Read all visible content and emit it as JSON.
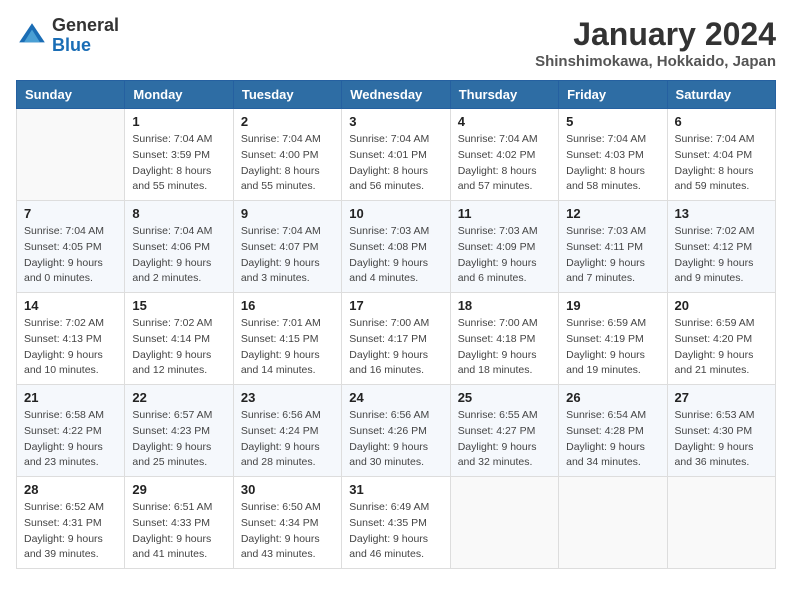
{
  "header": {
    "logo_line1": "General",
    "logo_line2": "Blue",
    "month": "January 2024",
    "location": "Shinshimokawa, Hokkaido, Japan"
  },
  "weekdays": [
    "Sunday",
    "Monday",
    "Tuesday",
    "Wednesday",
    "Thursday",
    "Friday",
    "Saturday"
  ],
  "weeks": [
    [
      {
        "day": "",
        "sunrise": "",
        "sunset": "",
        "daylight": ""
      },
      {
        "day": "1",
        "sunrise": "Sunrise: 7:04 AM",
        "sunset": "Sunset: 3:59 PM",
        "daylight": "Daylight: 8 hours and 55 minutes."
      },
      {
        "day": "2",
        "sunrise": "Sunrise: 7:04 AM",
        "sunset": "Sunset: 4:00 PM",
        "daylight": "Daylight: 8 hours and 55 minutes."
      },
      {
        "day": "3",
        "sunrise": "Sunrise: 7:04 AM",
        "sunset": "Sunset: 4:01 PM",
        "daylight": "Daylight: 8 hours and 56 minutes."
      },
      {
        "day": "4",
        "sunrise": "Sunrise: 7:04 AM",
        "sunset": "Sunset: 4:02 PM",
        "daylight": "Daylight: 8 hours and 57 minutes."
      },
      {
        "day": "5",
        "sunrise": "Sunrise: 7:04 AM",
        "sunset": "Sunset: 4:03 PM",
        "daylight": "Daylight: 8 hours and 58 minutes."
      },
      {
        "day": "6",
        "sunrise": "Sunrise: 7:04 AM",
        "sunset": "Sunset: 4:04 PM",
        "daylight": "Daylight: 8 hours and 59 minutes."
      }
    ],
    [
      {
        "day": "7",
        "sunrise": "Sunrise: 7:04 AM",
        "sunset": "Sunset: 4:05 PM",
        "daylight": "Daylight: 9 hours and 0 minutes."
      },
      {
        "day": "8",
        "sunrise": "Sunrise: 7:04 AM",
        "sunset": "Sunset: 4:06 PM",
        "daylight": "Daylight: 9 hours and 2 minutes."
      },
      {
        "day": "9",
        "sunrise": "Sunrise: 7:04 AM",
        "sunset": "Sunset: 4:07 PM",
        "daylight": "Daylight: 9 hours and 3 minutes."
      },
      {
        "day": "10",
        "sunrise": "Sunrise: 7:03 AM",
        "sunset": "Sunset: 4:08 PM",
        "daylight": "Daylight: 9 hours and 4 minutes."
      },
      {
        "day": "11",
        "sunrise": "Sunrise: 7:03 AM",
        "sunset": "Sunset: 4:09 PM",
        "daylight": "Daylight: 9 hours and 6 minutes."
      },
      {
        "day": "12",
        "sunrise": "Sunrise: 7:03 AM",
        "sunset": "Sunset: 4:11 PM",
        "daylight": "Daylight: 9 hours and 7 minutes."
      },
      {
        "day": "13",
        "sunrise": "Sunrise: 7:02 AM",
        "sunset": "Sunset: 4:12 PM",
        "daylight": "Daylight: 9 hours and 9 minutes."
      }
    ],
    [
      {
        "day": "14",
        "sunrise": "Sunrise: 7:02 AM",
        "sunset": "Sunset: 4:13 PM",
        "daylight": "Daylight: 9 hours and 10 minutes."
      },
      {
        "day": "15",
        "sunrise": "Sunrise: 7:02 AM",
        "sunset": "Sunset: 4:14 PM",
        "daylight": "Daylight: 9 hours and 12 minutes."
      },
      {
        "day": "16",
        "sunrise": "Sunrise: 7:01 AM",
        "sunset": "Sunset: 4:15 PM",
        "daylight": "Daylight: 9 hours and 14 minutes."
      },
      {
        "day": "17",
        "sunrise": "Sunrise: 7:00 AM",
        "sunset": "Sunset: 4:17 PM",
        "daylight": "Daylight: 9 hours and 16 minutes."
      },
      {
        "day": "18",
        "sunrise": "Sunrise: 7:00 AM",
        "sunset": "Sunset: 4:18 PM",
        "daylight": "Daylight: 9 hours and 18 minutes."
      },
      {
        "day": "19",
        "sunrise": "Sunrise: 6:59 AM",
        "sunset": "Sunset: 4:19 PM",
        "daylight": "Daylight: 9 hours and 19 minutes."
      },
      {
        "day": "20",
        "sunrise": "Sunrise: 6:59 AM",
        "sunset": "Sunset: 4:20 PM",
        "daylight": "Daylight: 9 hours and 21 minutes."
      }
    ],
    [
      {
        "day": "21",
        "sunrise": "Sunrise: 6:58 AM",
        "sunset": "Sunset: 4:22 PM",
        "daylight": "Daylight: 9 hours and 23 minutes."
      },
      {
        "day": "22",
        "sunrise": "Sunrise: 6:57 AM",
        "sunset": "Sunset: 4:23 PM",
        "daylight": "Daylight: 9 hours and 25 minutes."
      },
      {
        "day": "23",
        "sunrise": "Sunrise: 6:56 AM",
        "sunset": "Sunset: 4:24 PM",
        "daylight": "Daylight: 9 hours and 28 minutes."
      },
      {
        "day": "24",
        "sunrise": "Sunrise: 6:56 AM",
        "sunset": "Sunset: 4:26 PM",
        "daylight": "Daylight: 9 hours and 30 minutes."
      },
      {
        "day": "25",
        "sunrise": "Sunrise: 6:55 AM",
        "sunset": "Sunset: 4:27 PM",
        "daylight": "Daylight: 9 hours and 32 minutes."
      },
      {
        "day": "26",
        "sunrise": "Sunrise: 6:54 AM",
        "sunset": "Sunset: 4:28 PM",
        "daylight": "Daylight: 9 hours and 34 minutes."
      },
      {
        "day": "27",
        "sunrise": "Sunrise: 6:53 AM",
        "sunset": "Sunset: 4:30 PM",
        "daylight": "Daylight: 9 hours and 36 minutes."
      }
    ],
    [
      {
        "day": "28",
        "sunrise": "Sunrise: 6:52 AM",
        "sunset": "Sunset: 4:31 PM",
        "daylight": "Daylight: 9 hours and 39 minutes."
      },
      {
        "day": "29",
        "sunrise": "Sunrise: 6:51 AM",
        "sunset": "Sunset: 4:33 PM",
        "daylight": "Daylight: 9 hours and 41 minutes."
      },
      {
        "day": "30",
        "sunrise": "Sunrise: 6:50 AM",
        "sunset": "Sunset: 4:34 PM",
        "daylight": "Daylight: 9 hours and 43 minutes."
      },
      {
        "day": "31",
        "sunrise": "Sunrise: 6:49 AM",
        "sunset": "Sunset: 4:35 PM",
        "daylight": "Daylight: 9 hours and 46 minutes."
      },
      {
        "day": "",
        "sunrise": "",
        "sunset": "",
        "daylight": ""
      },
      {
        "day": "",
        "sunrise": "",
        "sunset": "",
        "daylight": ""
      },
      {
        "day": "",
        "sunrise": "",
        "sunset": "",
        "daylight": ""
      }
    ]
  ]
}
